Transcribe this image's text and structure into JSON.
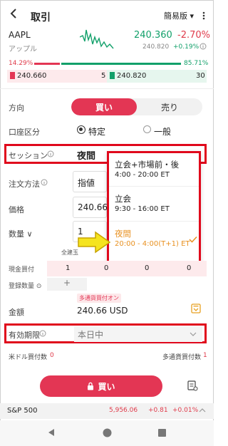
{
  "header": {
    "title": "取引",
    "mode": "簡易版"
  },
  "stock": {
    "symbol": "AAPL",
    "name": "アップル",
    "price": "240.360",
    "change_pct": "-2.70%",
    "sub_price": "240.820",
    "sub_change": "+0.19%"
  },
  "ratio": {
    "left_pct": "14.29%",
    "right_pct": "85.71%"
  },
  "book": {
    "bid": "240.660",
    "bid_qty": "5",
    "ask": "240.820",
    "ask_qty": "30"
  },
  "form": {
    "direction_label": "方向",
    "buy": "買い",
    "sell": "売り",
    "account_label": "口座区分",
    "account_specific": "特定",
    "account_general": "一般",
    "session_label": "セッション",
    "session_value": "夜間",
    "order_method_label": "注文方法",
    "order_method_value": "指値",
    "price_label": "価格",
    "price_value": "240.66",
    "qty_label": "数量",
    "qty_value": "1",
    "all_position": "全建玉",
    "cash_buy_label": "現金買付",
    "cash_buy_values": [
      "1",
      "0",
      "0",
      "0"
    ],
    "reg_qty_label": "登録数量",
    "plus": "+",
    "multi_badge": "多通貨買付オン",
    "amount_label": "金額",
    "amount_value": "240.66 USD",
    "expiry_label": "有効期限",
    "expiry_value": "本日中",
    "usd_buy_label": "米ドル買付数",
    "usd_buy_value": "0",
    "multi_buy_label": "多通貨買付数",
    "multi_buy_value": "1",
    "submit": "買い"
  },
  "session_options": [
    {
      "title": "立会+市場前・後",
      "time": "4:00 - 20:00 ET"
    },
    {
      "title": "立会",
      "time": "9:30 - 16:00 ET"
    },
    {
      "title": "夜間",
      "time": "20:00 - 4:00(T+1) ET"
    }
  ],
  "ticker": {
    "name": "S&P 500",
    "value": "5,956.06",
    "change": "+0.81",
    "pct": "+0.01%"
  },
  "colors": {
    "accent": "#e33654",
    "green": "#12a06a",
    "orange": "#e8901f",
    "highlight": "#e0081c"
  }
}
